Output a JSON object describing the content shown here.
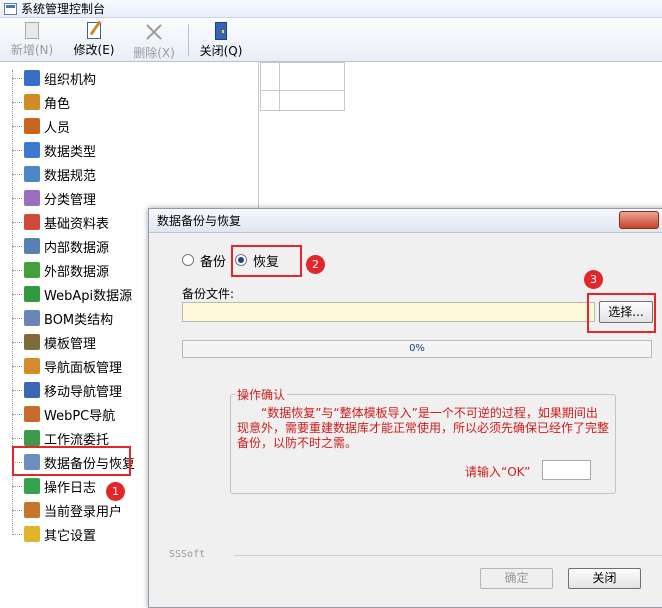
{
  "window": {
    "title": "系统管理控制台"
  },
  "toolbar": {
    "new": {
      "label": "新增(N)",
      "enabled": false
    },
    "edit": {
      "label": "修改(E)",
      "enabled": true
    },
    "delete": {
      "label": "删除(X)",
      "enabled": false
    },
    "close": {
      "label": "关闭(Q)",
      "enabled": true
    }
  },
  "tree": {
    "items": [
      {
        "label": "组织机构",
        "icon": "org-tree-icon",
        "color": "#3a6ec6"
      },
      {
        "label": "角色",
        "icon": "role-users-icon",
        "color": "#d28a24"
      },
      {
        "label": "人员",
        "icon": "user-icon",
        "color": "#c7661d"
      },
      {
        "label": "数据类型",
        "icon": "data-type-icon",
        "color": "#3c7ad2"
      },
      {
        "label": "数据规范",
        "icon": "data-spec-icon",
        "color": "#4a88c6"
      },
      {
        "label": "分类管理",
        "icon": "category-icon",
        "color": "#9a6fc2"
      },
      {
        "label": "基础资料表",
        "icon": "calendar-table-icon",
        "color": "#d04a3a"
      },
      {
        "label": "内部数据源",
        "icon": "internal-datasource-icon",
        "color": "#5a7fb4"
      },
      {
        "label": "外部数据源",
        "icon": "external-datasource-icon",
        "color": "#45a03a"
      },
      {
        "label": "WebApi数据源",
        "icon": "webapi-icon",
        "color": "#2f9a3a"
      },
      {
        "label": "BOM类结构",
        "icon": "bom-icon",
        "color": "#6a86b8"
      },
      {
        "label": "模板管理",
        "icon": "template-icon",
        "color": "#7f6b3a"
      },
      {
        "label": "导航面板管理",
        "icon": "nav-panel-icon",
        "color": "#d48b2d"
      },
      {
        "label": "移动导航管理",
        "icon": "mobile-nav-icon",
        "color": "#3a66b4"
      },
      {
        "label": "WebPC导航",
        "icon": "webpc-home-icon",
        "color": "#c86c2a"
      },
      {
        "label": "工作流委托",
        "icon": "workflow-icon",
        "color": "#3c9a4a"
      },
      {
        "label": "数据备份与恢复",
        "icon": "backup-restore-icon",
        "color": "#6a8fc0"
      },
      {
        "label": "操作日志",
        "icon": "log-icon",
        "color": "#35a34a"
      },
      {
        "label": "当前登录用户",
        "icon": "current-user-icon",
        "color": "#c8742c"
      },
      {
        "label": "其它设置",
        "icon": "settings-icon",
        "color": "#e0b52e"
      }
    ]
  },
  "dialog": {
    "title": "数据备份与恢复",
    "backup_label": "备份",
    "restore_label": "恢复",
    "selected_mode": "恢复",
    "file_label": "备份文件:",
    "file_value": "",
    "choose_label": "选择...",
    "progress": {
      "value": 0,
      "text": "0%"
    },
    "confirm": {
      "legend": "操作确认",
      "message": "“数据恢复”与“整体模板导入”是一个不可逆的过程，如果期间出现意外，需要重建数据库才能正常使用，所以必须先确保已经作了完整备份，以防不时之需。",
      "code_prompt": "请输入“OK”",
      "code_value": ""
    },
    "brand": "SSSoft",
    "ok_label": "确定",
    "close_label": "关闭"
  },
  "annotations": {
    "badge1": "1",
    "badge2": "2",
    "badge3": "3",
    "color": "#e3262a"
  }
}
